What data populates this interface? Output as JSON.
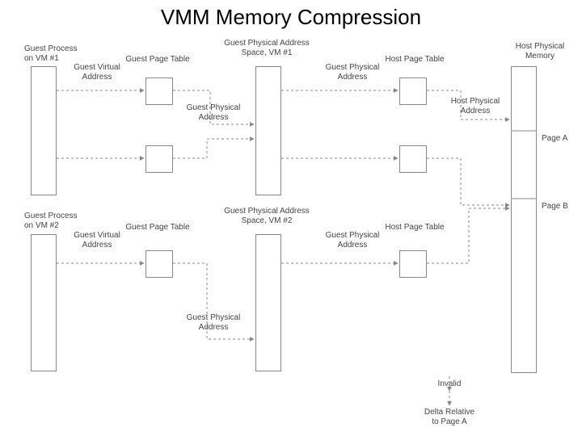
{
  "title": "VMM Memory Compression",
  "labels": {
    "guest_process_vm1": "Guest Process\non VM #1",
    "guest_virtual_address_1": "Guest Virtual\nAddress",
    "guest_page_table_1": "Guest Page Table",
    "guest_physical_address_1a": "Guest Physical\nAddress",
    "guest_physical_space_vm1": "Guest Physical Address\nSpace, VM #1",
    "guest_physical_address_1b": "Guest Physical\nAddress",
    "host_page_table_1": "Host Page Table",
    "host_physical_address_1": "Host Physical\nAddress",
    "host_physical_memory": "Host Physical\nMemory",
    "page_a": "Page A",
    "page_b": "Page B",
    "guest_process_vm2": "Guest Process\non VM #2",
    "guest_virtual_address_2": "Guest Virtual\nAddress",
    "guest_page_table_2": "Guest Page Table",
    "guest_physical_address_2a": "Guest Physical\nAddress",
    "guest_physical_space_vm2": "Guest Physical Address\nSpace, VM #2",
    "guest_physical_address_2b": "Guest Physical\nAddress",
    "host_page_table_2": "Host Page Table",
    "invalid": "Invalid",
    "delta_relative": "Delta Relative\nto Page A"
  }
}
